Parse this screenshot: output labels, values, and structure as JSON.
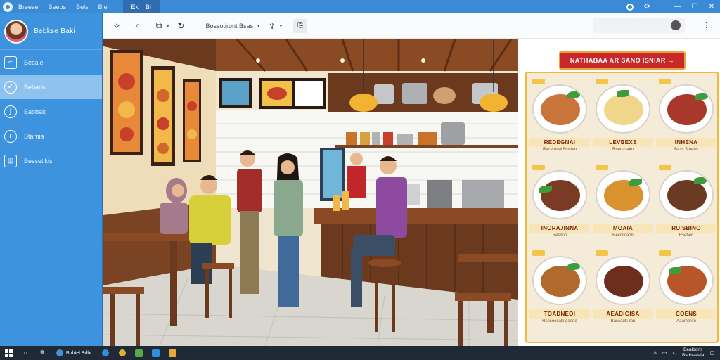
{
  "titlebar": {
    "menu_items": [
      "Breese",
      "Beebs",
      "Bels",
      "Ble"
    ],
    "tab_labels": [
      "Ek",
      "Bi"
    ]
  },
  "sidebar": {
    "profile_name": "Bebkse Baki",
    "items": [
      {
        "label": "Becale",
        "icon": "document-icon"
      },
      {
        "label": "Bebaris",
        "icon": "edit-icon",
        "active": true
      },
      {
        "label": "Baobalt",
        "icon": "clock-icon"
      },
      {
        "label": "Starnia",
        "icon": "globe-icon"
      },
      {
        "label": "Bessetikis",
        "icon": "grid-icon"
      }
    ]
  },
  "toolbar": {
    "location_label": "Bossotiront Bsas"
  },
  "menu": {
    "header": "NATHABAA AR SANO ISNIAR →",
    "dishes": [
      {
        "name": "REDEGNAI",
        "sub": "Receronal Rosten",
        "food_color": "#c8743a"
      },
      {
        "name": "LEVBEXS",
        "sub": "Rraxs sakn",
        "food_color": "#f0d68a"
      },
      {
        "name": "INHENA",
        "sub": "Bass Stoens",
        "food_color": "#a7382a"
      },
      {
        "name": "INORAJINNA",
        "sub": "Resson",
        "food_color": "#7a3a24"
      },
      {
        "name": "MOAIA",
        "sub": "Recolicaon",
        "food_color": "#d8922e"
      },
      {
        "name": "RUISBINO",
        "sub": "Rsehen",
        "food_color": "#6b3a22"
      },
      {
        "name": "TOADNEOI",
        "sub": "Rsosoesale gaoria",
        "food_color": "#b06a2c"
      },
      {
        "name": "AEADIGISA",
        "sub": "Bascadls ran",
        "food_color": "#6e2e1e"
      },
      {
        "name": "COENS",
        "sub": "Aaamoren",
        "food_color": "#b8562a"
      }
    ]
  },
  "taskbar": {
    "app_label": "Bubtel Bdbi",
    "clock_time": "Bealbons",
    "clock_date": "Bsdbssiaia"
  }
}
